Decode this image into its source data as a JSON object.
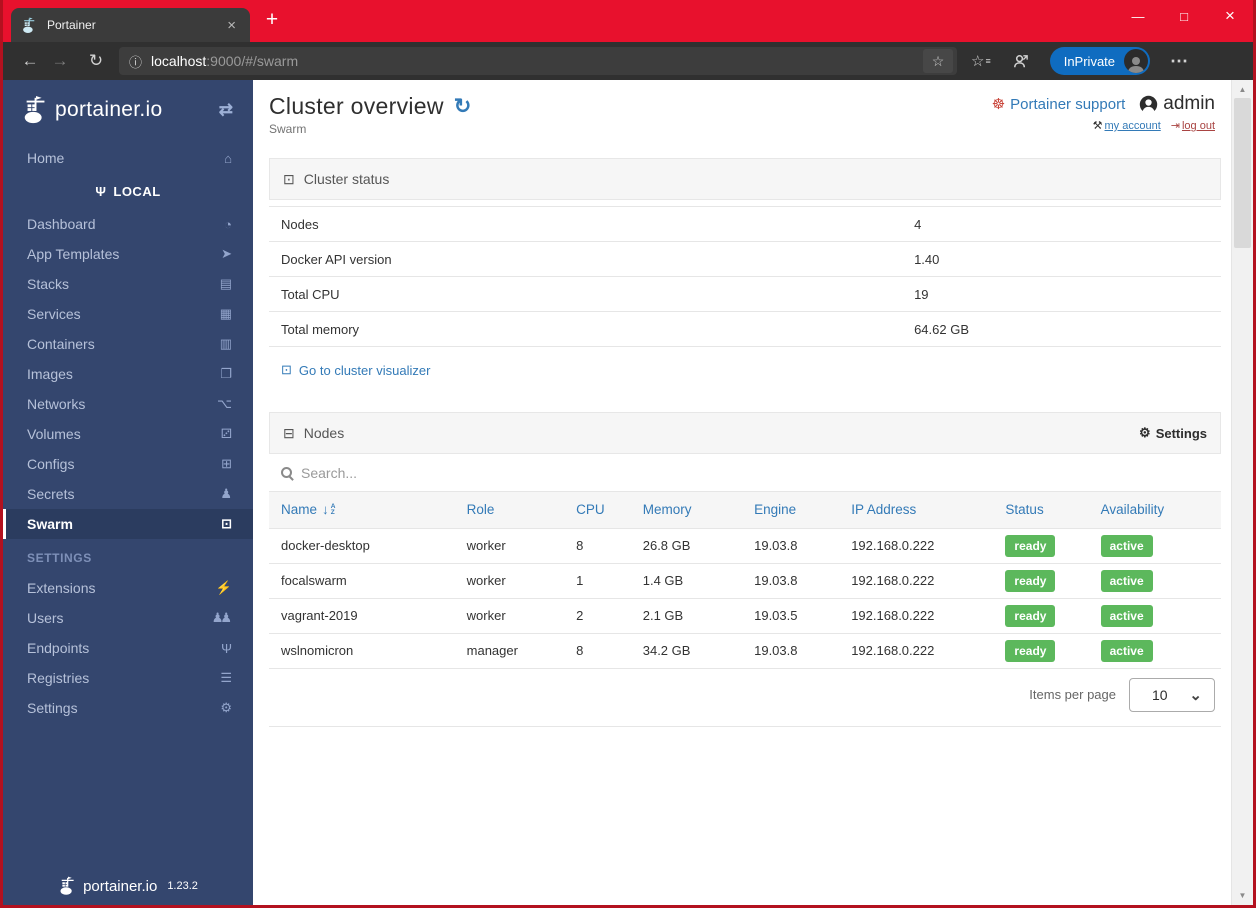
{
  "browser": {
    "tab_title": "Portainer",
    "url": {
      "host": "localhost",
      "rest": ":9000/#/swarm"
    },
    "inprivate_label": "InPrivate"
  },
  "icons": {
    "collapse": "⇄",
    "home": "⌂",
    "plug": "Ψ",
    "dashboard": "◔",
    "app_templates": "➤",
    "stacks": "▤",
    "services": "▦",
    "containers": "▥",
    "images": "❐",
    "networks": "⌥",
    "volumes": "⚂",
    "configs": "⊞",
    "secrets": "♟",
    "swarm": "⊡",
    "extensions": "⚡",
    "users": "♟♟",
    "endpoints": "Ψ",
    "registries": "☰",
    "settings_cogs": "⚙",
    "refresh": "↻",
    "life_ring": "☸",
    "wrench": "⚒",
    "sign_out": "⇥",
    "object_group": "⊡",
    "hdd": "⊟",
    "gear": "⚙",
    "sort_arrow": "↓",
    "chevron_down": "⌄",
    "back": "←",
    "forward": "→",
    "reload": "↻",
    "info": "ⓘ",
    "star": "☆",
    "fav_bar": "☆",
    "fav_bar_lines": "≡",
    "dots_menu": "⋯",
    "minimize": "—",
    "maximize": "□",
    "close": "×",
    "tab_close": "×",
    "new_tab": "+",
    "scroll_up": "▲",
    "scroll_down": "▼",
    "sort_a": "A",
    "sort_z": "Z"
  },
  "sidebar": {
    "logo_text": "portainer.io",
    "home_label": "Home",
    "local_label": "LOCAL",
    "items": [
      {
        "label": "Dashboard"
      },
      {
        "label": "App Templates"
      },
      {
        "label": "Stacks"
      },
      {
        "label": "Services"
      },
      {
        "label": "Containers"
      },
      {
        "label": "Images"
      },
      {
        "label": "Networks"
      },
      {
        "label": "Volumes"
      },
      {
        "label": "Configs"
      },
      {
        "label": "Secrets"
      },
      {
        "label": "Swarm"
      }
    ],
    "settings_header": "SETTINGS",
    "settings_items": [
      {
        "label": "Extensions"
      },
      {
        "label": "Users"
      },
      {
        "label": "Endpoints"
      },
      {
        "label": "Registries"
      },
      {
        "label": "Settings"
      }
    ],
    "footer": {
      "logo_text": "portainer.io",
      "version": "1.23.2"
    }
  },
  "header": {
    "title": "Cluster overview",
    "subtitle": "Swarm",
    "support_label": "Portainer support",
    "username": "admin",
    "my_account_label": "my account",
    "log_out_label": "log out"
  },
  "cluster_status": {
    "title": "Cluster status",
    "rows": [
      {
        "label": "Nodes",
        "value": "4"
      },
      {
        "label": "Docker API version",
        "value": "1.40"
      },
      {
        "label": "Total CPU",
        "value": "19"
      },
      {
        "label": "Total memory",
        "value": "64.62 GB"
      }
    ],
    "visualizer_link": "Go to cluster visualizer"
  },
  "nodes": {
    "title": "Nodes",
    "settings_label": "Settings",
    "search_placeholder": "Search...",
    "columns": [
      "Name",
      "Role",
      "CPU",
      "Memory",
      "Engine",
      "IP Address",
      "Status",
      "Availability"
    ],
    "rows": [
      {
        "name": "docker-desktop",
        "role": "worker",
        "cpu": "8",
        "memory": "26.8 GB",
        "engine": "19.03.8",
        "ip": "192.168.0.222",
        "status": "ready",
        "availability": "active"
      },
      {
        "name": "focalswarm",
        "role": "worker",
        "cpu": "1",
        "memory": "1.4 GB",
        "engine": "19.03.8",
        "ip": "192.168.0.222",
        "status": "ready",
        "availability": "active"
      },
      {
        "name": "vagrant-2019",
        "role": "worker",
        "cpu": "2",
        "memory": "2.1 GB",
        "engine": "19.03.5",
        "ip": "192.168.0.222",
        "status": "ready",
        "availability": "active"
      },
      {
        "name": "wslnomicron",
        "role": "manager",
        "cpu": "8",
        "memory": "34.2 GB",
        "engine": "19.03.8",
        "ip": "192.168.0.222",
        "status": "ready",
        "availability": "active"
      }
    ],
    "items_per_page_label": "Items per page",
    "items_per_page_value": "10"
  },
  "colors": {
    "accent_blue": "#337ab7",
    "sidebar_bg": "#34466e",
    "sidebar_active_bg": "#2b3c5f",
    "badge_green": "#5cb85c",
    "titlebar_red": "#e8112d",
    "inprivate_blue": "#0f6cc0",
    "danger_red": "#a94442"
  }
}
